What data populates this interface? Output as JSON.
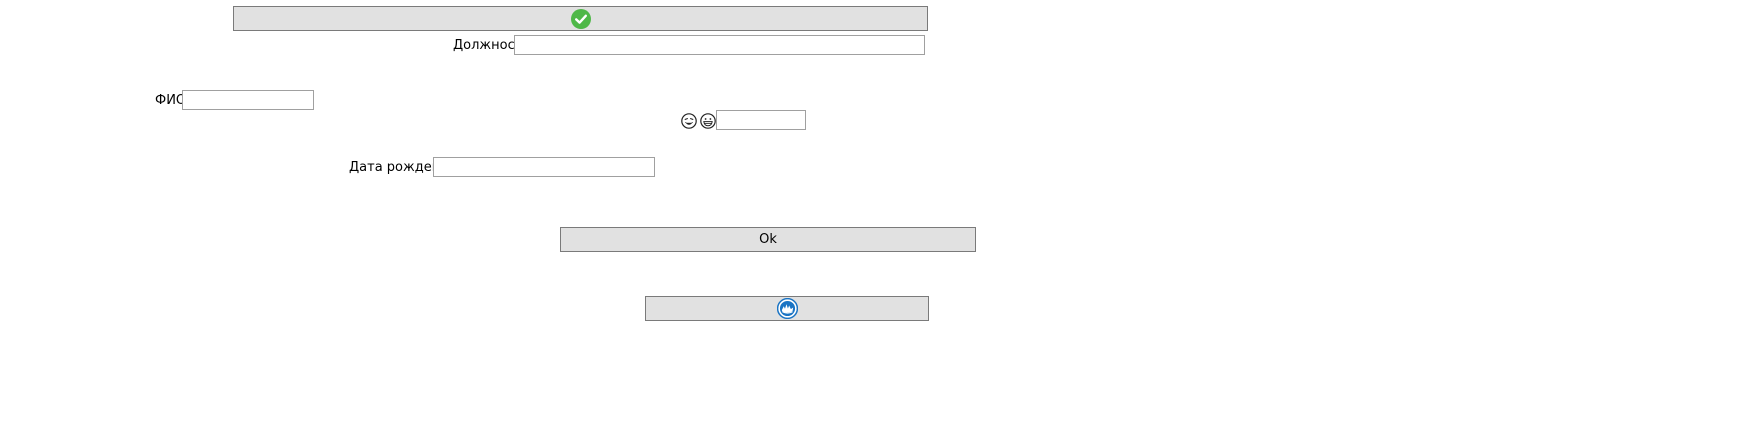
{
  "form": {
    "top_button": {
      "icon": "check-circle-icon",
      "color": "#4fb848"
    },
    "position_label": "Должность",
    "position_value": "",
    "fio_label": "ФИО",
    "fio_value": "",
    "emoji_icons": [
      "laughing-face-icon",
      "grinning-face-icon"
    ],
    "emoji_field_value": "",
    "birthdate_label": "Дата рождения",
    "birthdate_value": "",
    "ok_label": "Ok",
    "bottom_button": {
      "icon": "blue-circle-logo-icon",
      "color": "#1a74c4"
    }
  }
}
